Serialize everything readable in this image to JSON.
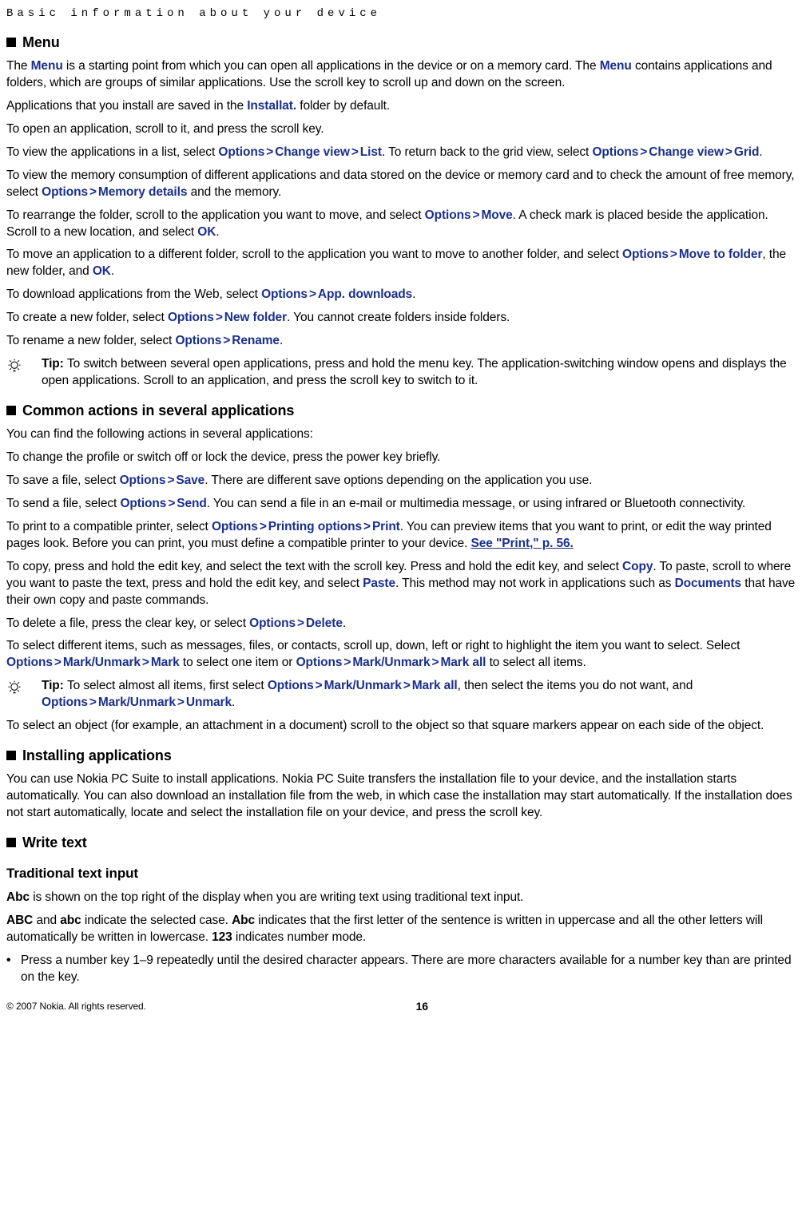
{
  "running_head": "Basic information about your device",
  "sections": {
    "menu": {
      "heading": "Menu",
      "p1a": "The ",
      "p1b": " is a starting point from which you can open all applications in the device or on a memory card. The ",
      "p1c": " contains applications and folders, which are groups of similar applications. Use the scroll key to scroll up and down on the screen.",
      "p2a": "Applications that you install are saved in the ",
      "p2b": " folder by default.",
      "p3": "To open an application, scroll to it, and press the scroll key.",
      "p4a": "To view the applications in a list, select ",
      "p4b": ". To return back to the grid view, select ",
      "p4c": ".",
      "p5a": "To view the memory consumption of different applications and data stored on the device or memory card and to check the amount of free memory, select ",
      "p5b": " and the memory.",
      "p6a": "To rearrange the folder, scroll to the application you want to move, and select ",
      "p6b": ". A check mark is placed beside the application. Scroll to a new location, and select ",
      "p6c": ".",
      "p7a": "To move an application to a different folder, scroll to the application you want to move to another folder, and select ",
      "p7b": ", the new folder, and ",
      "p7c": ".",
      "p8a": "To download applications from the Web, select ",
      "p8b": ".",
      "p9a": "To create a new folder, select ",
      "p9b": ". You cannot create folders inside folders.",
      "p10a": "To rename a new folder, select ",
      "p10b": ".",
      "tip_label": "Tip: ",
      "tip": "To switch between several open applications, press and hold the menu key. The application-switching window opens and displays the open applications. Scroll to an application, and press the scroll key to switch to it."
    },
    "common": {
      "heading": "Common actions in several applications",
      "p1": "You can find the following actions in several applications:",
      "p2": "To change the profile or switch off or lock the device, press the power key briefly.",
      "p3a": "To save a file, select ",
      "p3b": ". There are different save options depending on the application you use.",
      "p4a": "To send a file, select ",
      "p4b": ". You can send a file in an e-mail or multimedia message, or using infrared or Bluetooth connectivity.",
      "p5a": "To print to a compatible printer, select ",
      "p5b": ". You can preview items that you want to print, or edit the way printed pages look. Before you can print, you must define a compatible printer to your device. ",
      "p5_link": "See \"Print,\" p. 56.",
      "p6a": "To copy, press and hold the edit key, and select the text with the scroll key. Press and hold the edit key, and select ",
      "p6b": ". To paste, scroll to where you want to paste the text, press and hold the edit key, and select ",
      "p6c": ". This method may not work in applications such as ",
      "p6d": " that have their own copy and paste commands.",
      "p7a": "To delete a file, press the clear key, or select ",
      "p7b": ".",
      "p8a": "To select different items, such as messages, files, or contacts, scroll up, down, left or right to highlight the item you want to select. Select ",
      "p8b": " to select one item or ",
      "p8c": " to select all items.",
      "tip_label": "Tip: ",
      "tip_a": "To select almost all items, first select ",
      "tip_b": ", then select the items you do not want, and ",
      "tip_c": ".",
      "p9": "To select an object (for example, an attachment in a document) scroll to the object so that square markers appear on each side of the object."
    },
    "install": {
      "heading": "Installing applications",
      "p1": "You can use Nokia PC Suite to install applications. Nokia PC Suite transfers the installation file to your device, and the installation starts automatically. You can also download an installation file from the web, in which case the installation may start automatically. If the installation does not start automatically, locate and select the installation file on your device, and press the scroll key."
    },
    "write": {
      "heading": "Write text",
      "sub": "Traditional text input",
      "p1a": " is shown on the top right of the display when you are writing text using traditional text input.",
      "p2a": " and ",
      "p2b": " indicate the selected case. ",
      "p2c": " indicates that the first letter of the sentence is written in uppercase and all the other letters will automatically be written in lowercase. ",
      "p2d": " indicates number mode.",
      "bullet": "Press a number key 1–9 repeatedly until the desired character appears. There are more characters available for a number key than are printed on the key."
    }
  },
  "kw": {
    "Menu": "Menu",
    "Installat": "Installat.",
    "Options": "Options",
    "ChangeView": "Change view",
    "List": "List",
    "Grid": "Grid",
    "MemoryDetails": "Memory details",
    "Move": "Move",
    "OK": "OK",
    "MoveToFolder": "Move to folder",
    "AppDownloads": "App. downloads",
    "NewFolder": "New folder",
    "Rename": "Rename",
    "Save": "Save",
    "Send": "Send",
    "PrintingOptions": "Printing options",
    "Print": "Print",
    "Copy": "Copy",
    "Paste": "Paste",
    "Documents": "Documents",
    "Delete": "Delete",
    "MarkUnmark": "Mark/Unmark",
    "Mark": "Mark",
    "MarkAll": "Mark all",
    "Unmark": "Unmark"
  },
  "indicators": {
    "Abc": "Abc",
    "ABC": "ABC",
    "abc": "abc",
    "num": "123"
  },
  "footer": {
    "copyright": "© 2007 Nokia. All rights reserved.",
    "page": "16"
  }
}
